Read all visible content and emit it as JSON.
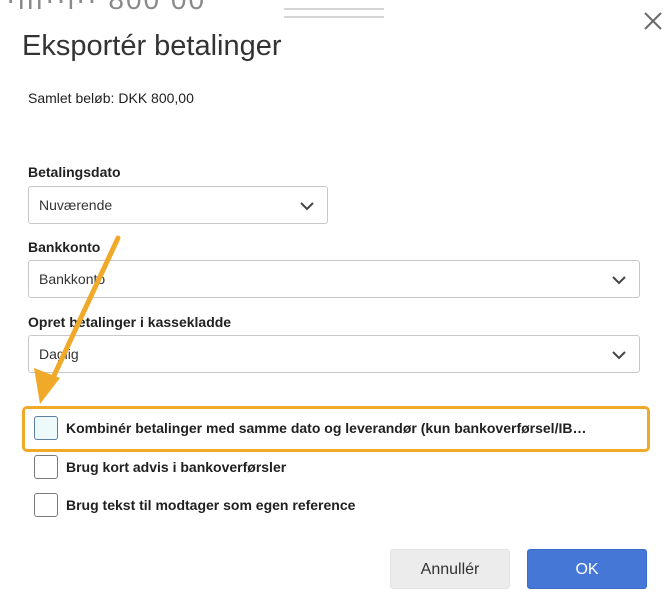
{
  "background": {
    "partial_text": "·ılı··l·· 800 00"
  },
  "dialog": {
    "title": "Eksportér betalinger",
    "total": {
      "label": "Samlet beløb:",
      "value": "DKK 800,00"
    },
    "fields": {
      "payment_date": {
        "label": "Betalingsdato",
        "value": "Nuværende"
      },
      "bank_account": {
        "label": "Bankkonto",
        "value": "Bankkonto"
      },
      "journal": {
        "label": "Opret betalinger i kassekladde",
        "value": "Daglig"
      }
    },
    "checkboxes": [
      {
        "label": "Kombinér betalinger med samme dato og leverandør (kun bankoverførsel/IB…",
        "checked": false,
        "highlighted": true
      },
      {
        "label": "Brug kort advis i bankoverførsler",
        "checked": false
      },
      {
        "label": "Brug tekst til modtager som egen reference",
        "checked": false
      }
    ],
    "buttons": {
      "cancel": "Annullér",
      "ok": "OK"
    }
  },
  "colors": {
    "primary": "#4477d6",
    "highlight": "#f0a929",
    "border": "#c8c8c8"
  },
  "icons": {
    "close": "close-icon",
    "dropdown": "chevron-down-icon",
    "annotation": "arrow-annotation"
  }
}
